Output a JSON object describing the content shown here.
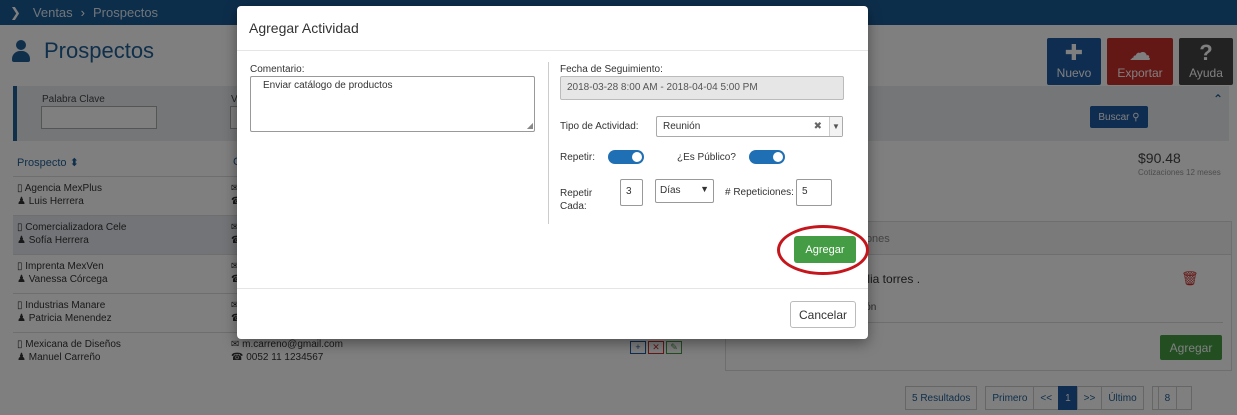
{
  "breadcrumb": {
    "items": [
      "Ventas",
      "Prospectos"
    ]
  },
  "page": {
    "title": "Prospectos"
  },
  "actions": {
    "nuevo": "Nuevo",
    "exportar": "Exportar",
    "ayuda": "Ayuda"
  },
  "filters": {
    "palabra_clave_label": "Palabra Clave",
    "second_label": "V",
    "buscar": "Buscar"
  },
  "table": {
    "header_prospecto": "Prospecto",
    "header_contacto": "C",
    "rows": [
      {
        "company": "Agencia MexPlus",
        "person": "Luis Herrera"
      },
      {
        "company": "Comercializadora Cele",
        "person": "Sofía Herrera"
      },
      {
        "company": "Imprenta MexVen",
        "person": "Vanessa Córcega"
      },
      {
        "company": "Industrias Manare",
        "person": "Patricia Menendez"
      },
      {
        "company": "Mexicana de Diseños",
        "person": "Manuel Carreño",
        "email": "m.carreno@gmail.com",
        "phone": "0052 11 1234567"
      }
    ]
  },
  "stats": {
    "amount": "$90.48",
    "amount_sub": "Cotizaciones 12 meses"
  },
  "activities": {
    "header": "ciones",
    "item_text": "julia torres .",
    "item_sub": "ción",
    "agregar": "Agregar"
  },
  "pagination": {
    "results": "5 Resultados",
    "first": "Primero",
    "prev": "<<",
    "current": "1",
    "next": ">>",
    "last": "Último",
    "per_page": "8"
  },
  "modal": {
    "title": "Agregar Actividad",
    "comentario_label": "Comentario:",
    "comentario_value": "Enviar catálogo de productos",
    "fecha_label": "Fecha de Seguimiento:",
    "fecha_value": "2018-03-28 8:00 AM - 2018-04-04 5:00 PM",
    "tipo_label": "Tipo de Actividad:",
    "tipo_value": "Reunión",
    "repetir_label": "Repetir:",
    "repetir_on": true,
    "publico_label": "¿Es Público?",
    "publico_on": true,
    "repetir_cada_label": "Repetir Cada:",
    "repetir_cada_value": "3",
    "unidad_value": "Días",
    "repeticiones_label": "# Repeticiones:",
    "repeticiones_value": "5",
    "agregar": "Agregar",
    "cancelar": "Cancelar"
  },
  "colors": {
    "primary": "#1f5aa0",
    "success": "#449d44",
    "danger": "#c9302c",
    "highlight_ring": "#c4161c"
  }
}
